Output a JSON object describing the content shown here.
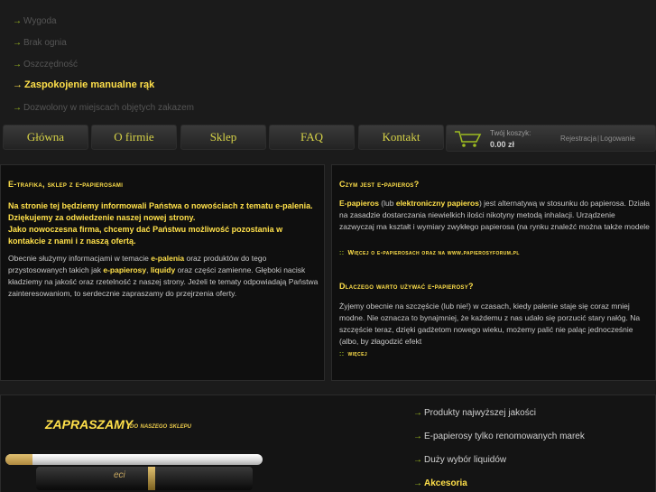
{
  "features": [
    {
      "label": "Wygoda",
      "active": false
    },
    {
      "label": "Brak ognia",
      "active": false
    },
    {
      "label": "Oszczędność",
      "active": false
    },
    {
      "label": "Zaspokojenie manualne rąk",
      "active": true
    },
    {
      "label": "Dozwolony w miejscach objętych zakazem",
      "active": false
    }
  ],
  "nav": [
    "Główna",
    "O firmie",
    "Sklep",
    "FAQ",
    "Kontakt"
  ],
  "cart": {
    "label": "Twój koszyk:",
    "total": "0.00 zł"
  },
  "auth": {
    "register": "Rejestracja",
    "separator": "|",
    "login": "Logowanie"
  },
  "left_panel": {
    "title": "E-trafika, sklep z e-papierosami",
    "lead_1": "Na stronie tej będziemy informowali Państwa o nowościach z tematu e-palenia. Dziękujemy za odwiedzenie naszej nowej strony.",
    "lead_2": "Jako nowoczesna firma, chcemy dać Państwu możliwość pozostania w kontakcie z nami i z naszą ofertą.",
    "body_a": "Obecnie służymy informacjami w temacie ",
    "body_b": "e-palenia",
    "body_c": " oraz produktów do tego przystosowanych takich jak ",
    "body_d": "e-papierosy",
    "body_e": ", ",
    "body_f": "liquidy",
    "body_g": " oraz części zamienne. Głęboki nacisk kładziemy na jakość oraz rzetelność z naszej strony. Jeżeli te tematy odpowiadają Państwa zainteresowaniom, to serdecznie zapraszamy do przejrzenia oferty."
  },
  "right_panel": {
    "q1_title": "Czym jest e-papieros?",
    "q1_a": "E-papieros",
    "q1_b": " (lub ",
    "q1_c": "elektroniczny papieros",
    "q1_d": ") jest alternatywą w stosunku do papierosa. Działa na zasadzie dostarczania niewielkich ilości nikotyny metodą inhalacji. Urządzenie zazwyczaj ma kształt i wymiary zwykłego papierosa (na rynku znaleźć można także modele",
    "q1_more_dots": "::",
    "q1_more": "Więcej o e-papierosach oraz na   www.papierosyforum.pl",
    "q2_title": "Dlaczego warto używać e-papierosy?",
    "q2_text": "Żyjemy obecnie na szczęście (lub nie!) w czasach, kiedy palenie staje się coraz mniej modne. Nie oznacza to bynajmniej, że każdemu z nas udało się porzucić stary nałóg. Na szczęście teraz, dzięki gadżetom nowego wieku, możemy palić nie paląc jednocześnie (albo, by złagodzić efekt",
    "q2_more_dots": "::",
    "q2_more": "więcej"
  },
  "promo": {
    "title": "ZAPRASZAMY",
    "subtitle": "do naszego sklepu",
    "product_label": "eci"
  },
  "benefits": [
    {
      "label": "Produkty najwyższej jakości",
      "highlight": false
    },
    {
      "label": "E-papierosy tylko renomowanych marek",
      "highlight": false
    },
    {
      "label": "Duży wybór liquidów",
      "highlight": false
    },
    {
      "label": "Akcesoria",
      "highlight": true
    }
  ],
  "arrow_glyph": "→",
  "colors": {
    "accent": "#ffe04a",
    "green": "#9dbb21",
    "nav_text": "#d6d247"
  }
}
